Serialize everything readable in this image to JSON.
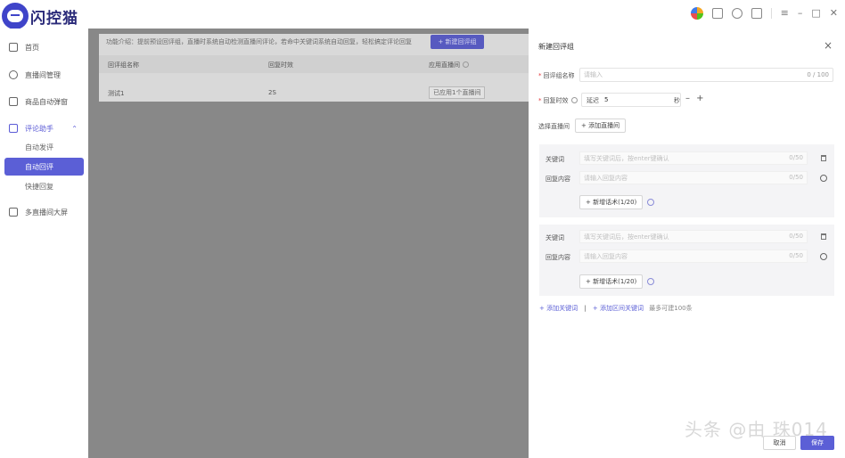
{
  "app": {
    "name": "闪控猫"
  },
  "topbar": {
    "icons": [
      "avatar-icon",
      "clipboard-icon",
      "headset-icon",
      "edit-icon",
      "menu-icon",
      "minimize-icon",
      "restore-icon",
      "close-icon"
    ],
    "min_glyph": "–",
    "max_glyph": "□",
    "close_glyph": "✕",
    "menu_glyph": "≡"
  },
  "sidebar": {
    "home": "首页",
    "live_room": "直播间管理",
    "product_popup": "商品自动弹窗",
    "comment_assistant": "评论助手",
    "caret": "⌃",
    "auto_comment": "自动发评",
    "auto_reply": "自动回评",
    "quick_reply": "快捷回复",
    "multi_live_screen": "多直播间大屏"
  },
  "main": {
    "intro": "功能介绍：提前预设回评组，直播时系统自动检测直播间评论，若命中关键词系统自动回复，轻松搞定评论回复",
    "new_group_button": "+ 新建回评组",
    "columns": {
      "name": "回评组名称",
      "effect": "回复时效",
      "applied": "应用直播间"
    },
    "rows": [
      {
        "name": "测试1",
        "effect": "2S",
        "applied": "已应用1个直播间"
      }
    ]
  },
  "drawer": {
    "title": "新建回评组",
    "close": "×",
    "group_name_label": "回评组名称",
    "group_name_placeholder": "请输入",
    "group_name_counter": "0 / 100",
    "reply_time_label": "回复时效",
    "delay_word": "延迟",
    "delay_value": "5",
    "unit": "秒",
    "stepper": "– +",
    "select_live_label": "选择直播间",
    "add_live_button": "+ 添加直播间",
    "keyword_blocks": [
      {
        "keyword_label": "关键词",
        "keyword_placeholder": "填写关键词后，按enter键确认",
        "keyword_counter": "0/50",
        "reply_label": "回复内容",
        "reply_placeholder": "请输入回复内容",
        "reply_counter": "0/50",
        "add_script_button": "+ 新增话术(1/20)"
      },
      {
        "keyword_label": "关键词",
        "keyword_placeholder": "填写关键词后，按enter键确认",
        "keyword_counter": "0/50",
        "reply_label": "回复内容",
        "reply_placeholder": "请输入回复内容",
        "reply_counter": "0/50",
        "add_script_button": "+ 新增话术(1/20)"
      }
    ],
    "add_keyword_link": "+ 添加关键词",
    "separator": "|",
    "add_range_keyword_link": "+ 添加区间关键词",
    "limit_note": "最多可建100条",
    "cancel_button": "取消",
    "save_button": "保存"
  },
  "watermark": "头条 @由 珠014"
}
